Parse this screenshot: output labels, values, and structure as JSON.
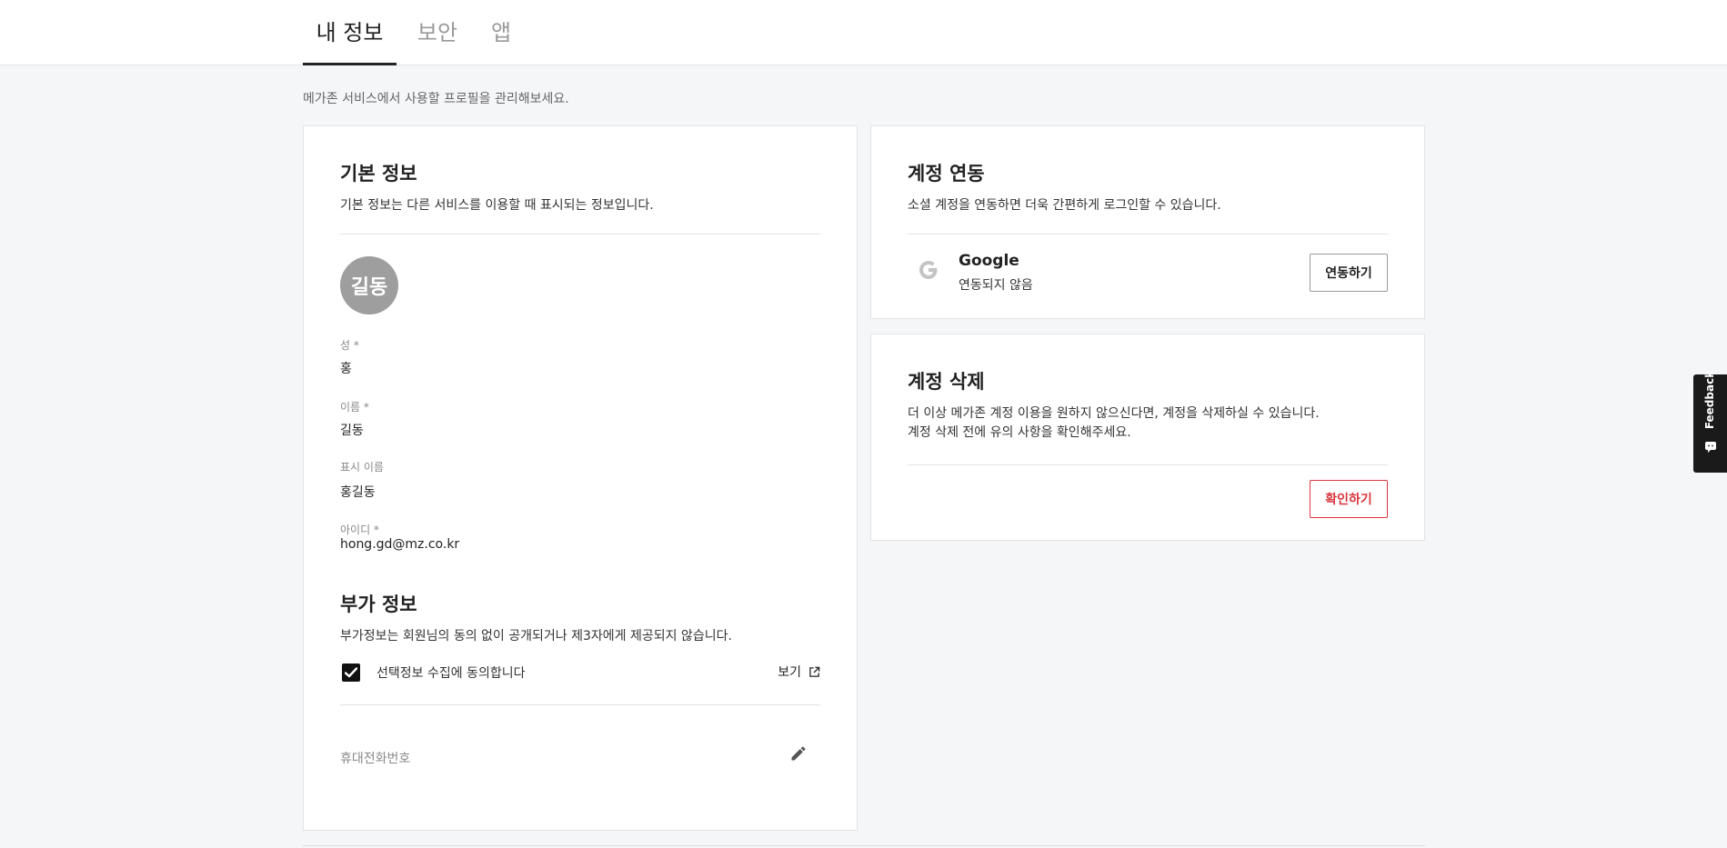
{
  "tabs": [
    {
      "label": "내 정보",
      "active": true
    },
    {
      "label": "보안",
      "active": false
    },
    {
      "label": "앱",
      "active": false
    }
  ],
  "intro": "메가존 서비스에서 사용할 프로필을 관리해보세요.",
  "basic_info": {
    "title": "기본 정보",
    "desc": "기본 정보는 다른 서비스를 이용할 때 표시되는 정보입니다.",
    "avatar_text": "길동",
    "fields": [
      {
        "label": "성 *",
        "value": "홍"
      },
      {
        "label": "이름 *",
        "value": "길동"
      },
      {
        "label": "표시 이름",
        "value": "홍길동"
      },
      {
        "label": "아이디 *",
        "value": "hong.gd@mz.co.kr"
      }
    ]
  },
  "extra_info": {
    "title": "부가 정보",
    "desc": "부가정보는 회원님의 동의 없이 공개되거나 제3자에게 제공되지 않습니다.",
    "consent_label": "선택정보 수집에 동의합니다",
    "consent_checked": true,
    "view_link": "보기",
    "phone_label": "휴대전화번호"
  },
  "account_link": {
    "title": "계정 연동",
    "desc": "소셜 계정을 연동하면 더욱 간편하게 로그인할 수 있습니다.",
    "provider": "Google",
    "status": "연동되지 않음",
    "button": "연동하기"
  },
  "account_delete": {
    "title": "계정 삭제",
    "desc_line1": "더 이상 메가존 계정 이용을 원하지 않으신다면, 계정을 삭제하실 수 있습니다.",
    "desc_line2": "계정 삭제 전에 유의 사항을 확인해주세요.",
    "button": "확인하기"
  },
  "feedback": {
    "label": "Feedback"
  },
  "colors": {
    "danger": "#d9363e",
    "avatar_bg": "#9e9e9e"
  }
}
